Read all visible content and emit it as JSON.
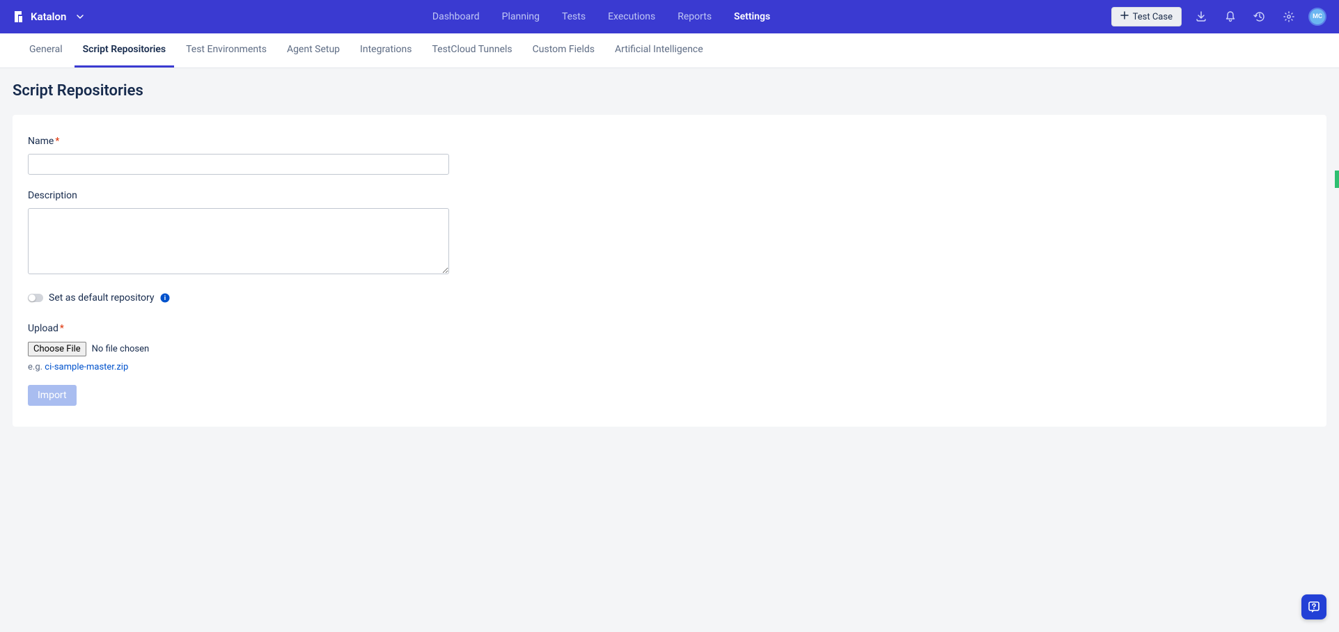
{
  "header": {
    "app_name": "Katalon",
    "nav": [
      {
        "label": "Dashboard",
        "active": false
      },
      {
        "label": "Planning",
        "active": false
      },
      {
        "label": "Tests",
        "active": false
      },
      {
        "label": "Executions",
        "active": false
      },
      {
        "label": "Reports",
        "active": false
      },
      {
        "label": "Settings",
        "active": true
      }
    ],
    "test_case_btn": "Test Case",
    "avatar_initials": "MC"
  },
  "sub_tabs": [
    {
      "label": "General",
      "active": false
    },
    {
      "label": "Script Repositories",
      "active": true
    },
    {
      "label": "Test Environments",
      "active": false
    },
    {
      "label": "Agent Setup",
      "active": false
    },
    {
      "label": "Integrations",
      "active": false
    },
    {
      "label": "TestCloud Tunnels",
      "active": false
    },
    {
      "label": "Custom Fields",
      "active": false
    },
    {
      "label": "Artificial Intelligence",
      "active": false
    }
  ],
  "page": {
    "title": "Script Repositories",
    "form": {
      "name_label": "Name",
      "description_label": "Description",
      "default_repo_label": "Set as default repository",
      "upload_label": "Upload",
      "choose_file_btn": "Choose File",
      "no_file_text": "No file chosen",
      "example_prefix": "e.g. ",
      "example_link": "ci-sample-master.zip",
      "import_btn": "Import"
    }
  }
}
